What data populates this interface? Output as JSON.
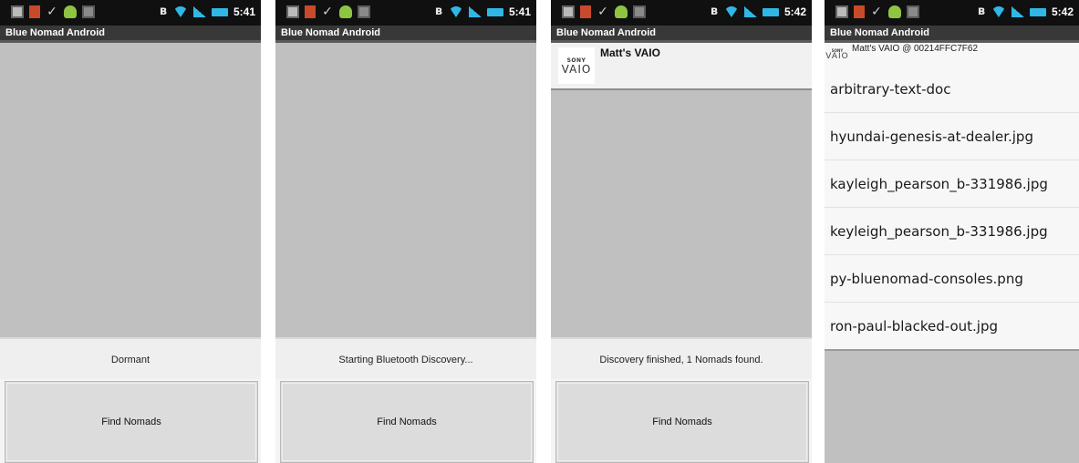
{
  "app": {
    "title": "Blue Nomad Android"
  },
  "screens": [
    {
      "time": "5:41",
      "status": "Dormant",
      "button": "Find Nomads"
    },
    {
      "time": "5:41",
      "status": "Starting Bluetooth Discovery...",
      "button": "Find Nomads"
    },
    {
      "time": "5:42",
      "status": "Discovery finished, 1 Nomads found.",
      "button": "Find Nomads",
      "device": {
        "logo_top": "SONY",
        "logo_main": "VAIO",
        "name": "Matt's VAIO"
      }
    },
    {
      "time": "5:42",
      "connection": {
        "logo_top": "SONY",
        "logo_main": "VAIO",
        "label": "Matt's VAIO @ 00214FFC7F62"
      },
      "files": [
        "arbitrary-text-doc",
        "hyundai-genesis-at-dealer.jpg",
        "kayleigh_pearson_b-331986.jpg",
        "keyleigh_pearson_b-331986.jpg",
        "py-bluenomad-consoles.png",
        "ron-paul-blacked-out.jpg"
      ]
    }
  ],
  "icons": {
    "status_left": [
      "notification-box-icon",
      "usb-icon",
      "check-icon",
      "android-icon",
      "sd-card-icon"
    ],
    "status_right": [
      "bluetooth-icon",
      "wifi-icon",
      "signal-icon",
      "battery-icon"
    ]
  },
  "colors": {
    "status_bar": "#101010",
    "title_bar": "#383838",
    "accent": "#2fb8e6",
    "content_bg": "#c0c0c0"
  }
}
